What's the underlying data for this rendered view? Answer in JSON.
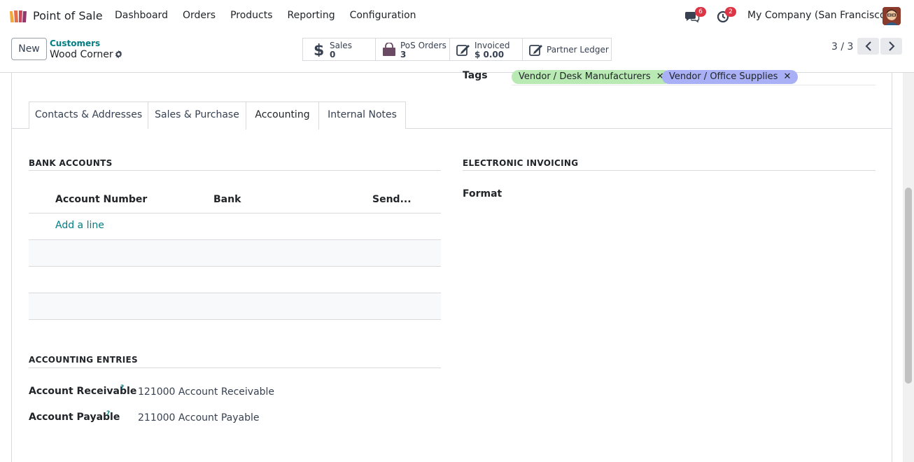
{
  "navbar": {
    "app_name": "Point of Sale",
    "menu": [
      "Dashboard",
      "Orders",
      "Products",
      "Reporting",
      "Configuration"
    ],
    "messages_badge": "6",
    "activities_badge": "2",
    "company": "My Company (San Francisco)"
  },
  "control": {
    "new_label": "New",
    "breadcrumb_parent": "Customers",
    "breadcrumb_current": "Wood Corner",
    "stats": {
      "sales": {
        "label": "Sales",
        "value": "0"
      },
      "pos_orders": {
        "label": "PoS Orders",
        "value": "3"
      },
      "invoiced": {
        "label": "Invoiced",
        "value": "$ 0.00"
      },
      "partner_ledger": {
        "label": "Partner Ledger"
      }
    },
    "pager": "3 / 3"
  },
  "form": {
    "tags_label": "Tags",
    "tags": [
      {
        "label": "Vendor / Desk Manufacturers",
        "color": "#b9eab4"
      },
      {
        "label": "Vendor / Office Supplies",
        "color": "#a9b0f5"
      }
    ],
    "tabs": [
      "Contacts & Addresses",
      "Sales & Purchase",
      "Accounting",
      "Internal Notes"
    ],
    "active_tab": "Accounting",
    "bank_accounts": {
      "title": "BANK ACCOUNTS",
      "columns": [
        "Account Number",
        "Bank",
        "Send..."
      ],
      "add_line": "Add a line"
    },
    "electronic_invoicing": {
      "title": "ELECTRONIC INVOICING",
      "format_label": "Format"
    },
    "accounting_entries": {
      "title": "ACCOUNTING ENTRIES",
      "receivable_label": "Account Receivable",
      "receivable_value": "121000 Account Receivable",
      "payable_label": "Account Payable",
      "payable_value": "211000 Account Payable",
      "help_mark": "?"
    }
  },
  "colors": {
    "accent": "#017e84",
    "badge": "#dc3545",
    "brand": "#714b67"
  }
}
